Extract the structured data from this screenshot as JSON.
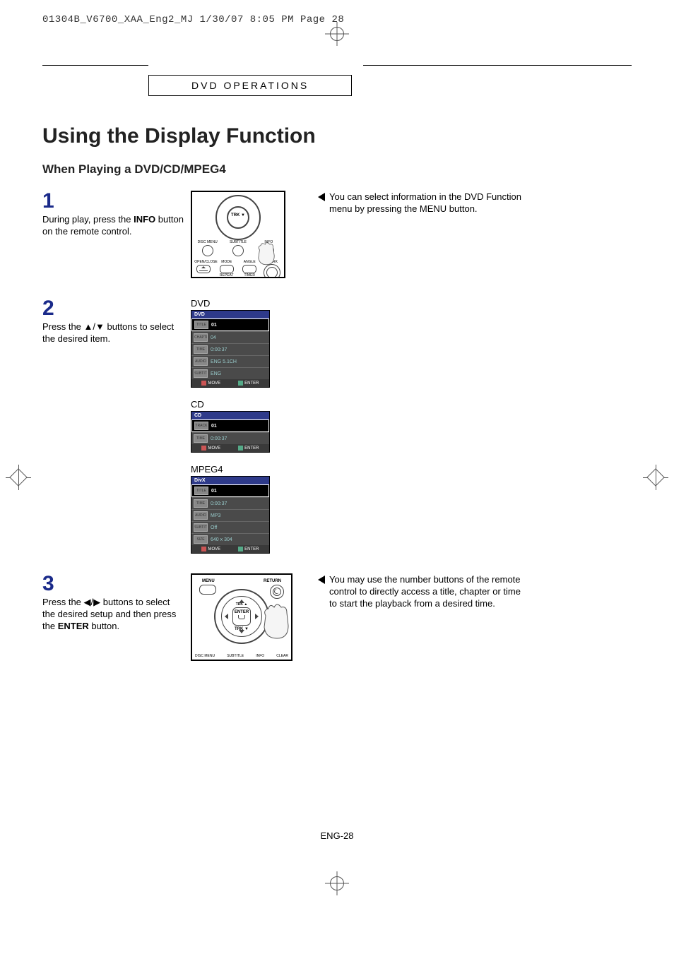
{
  "meta_line": "01304B_V6700_XAA_Eng2_MJ  1/30/07  8:05 PM  Page 28",
  "section_header": "DVD OPERATIONS",
  "title": "Using the Display Function",
  "subtitle": "When Playing a DVD/CD/MPEG4",
  "steps": {
    "s1": {
      "num": "1",
      "text_before": "During play, press the ",
      "bold": "INFO",
      "text_after": " button on the remote control."
    },
    "s2": {
      "num": "2",
      "text_before": "Press the ",
      "symbols": "▲/▼",
      "text_after": " buttons to select the desired item."
    },
    "s3": {
      "num": "3",
      "text_before": "Press the ",
      "symbols": "◀/▶",
      "text_mid": " buttons to select the desired setup and then press the ",
      "bold": "ENTER",
      "text_after": " button."
    }
  },
  "notes": {
    "n1": "You can select information in the DVD Function menu by pressing the MENU button.",
    "n3": "You may use the number buttons of the remote control to directly access a title, chapter or time to start the playback from a desired time."
  },
  "remote1": {
    "trk": "TRK ▼",
    "row1": {
      "a": "DISC MENU",
      "b": "SUBTITLE",
      "c": "INFO"
    },
    "row2": {
      "a": "OPEN/CLOSE",
      "b": "MODE",
      "b2": "REPEAT",
      "c": "ANGLE",
      "c2": "TIMER",
      "d": "MARK"
    }
  },
  "osd_labels": {
    "dvd": "DVD",
    "cd": "CD",
    "mpeg4": "MPEG4"
  },
  "osd_dvd": {
    "hdr": "DVD",
    "rows": [
      {
        "icon": "TITLE",
        "val": "01",
        "sel": true
      },
      {
        "icon": "CHAPTER",
        "val": "04"
      },
      {
        "icon": "TIME",
        "val": "0:00:37"
      },
      {
        "icon": "AUDIO",
        "val": "ENG 5.1CH"
      },
      {
        "icon": "SUBTITLE",
        "val": "ENG"
      }
    ],
    "footer": {
      "a": "MOVE",
      "b": "ENTER"
    }
  },
  "osd_cd": {
    "hdr": "CD",
    "rows": [
      {
        "icon": "TRACK",
        "val": "01",
        "sel": true
      },
      {
        "icon": "TIME",
        "val": "0:00:37"
      }
    ],
    "footer": {
      "a": "MOVE",
      "b": "ENTER"
    }
  },
  "osd_mpeg4": {
    "hdr": "DivX",
    "rows": [
      {
        "icon": "TITLE",
        "val": "01",
        "sel": true
      },
      {
        "icon": "TIME",
        "val": "0:00:37"
      },
      {
        "icon": "AUDIO",
        "val": "MP3"
      },
      {
        "icon": "SUBTITLE",
        "val": "Off"
      },
      {
        "icon": "SIZE",
        "val": "640 x 304"
      }
    ],
    "footer": {
      "a": "MOVE",
      "b": "ENTER"
    }
  },
  "remote3": {
    "menu": "MENU",
    "return": "RETURN",
    "trk_up": "TRK ▲",
    "trk_dn": "TRK ▼",
    "enter": "ENTER",
    "bottom": {
      "a": "DISC MENU",
      "b": "SUBTITLE",
      "c": "INFO",
      "d": "CLEAR"
    }
  },
  "page_number": "ENG-28"
}
